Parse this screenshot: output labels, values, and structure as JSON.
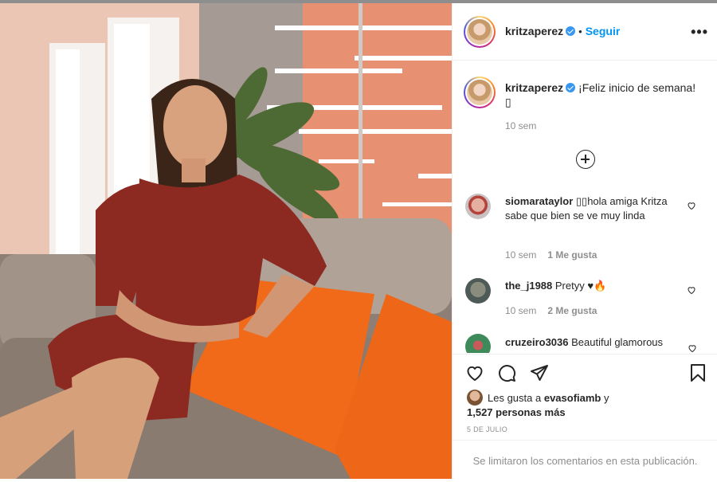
{
  "post": {
    "author": "kritzaperez",
    "follow_label": "Seguir",
    "more_label": "•••",
    "caption": "¡Feliz inicio de semana!",
    "caption_emoji": "▯",
    "caption_age": "10 sem"
  },
  "comments": [
    {
      "user": "siomarataylor",
      "text": "▯▯hola amiga Kritza sabe que bien se ve muy linda",
      "age": "10 sem",
      "likes": "1 Me gusta"
    },
    {
      "user": "the_j1988",
      "text": "Pretyy ♥🔥",
      "age": "10 sem",
      "likes": "2 Me gusta"
    },
    {
      "user": "cruzeiro3036",
      "text": "Beautiful glamorous"
    }
  ],
  "likes": {
    "prefix": "Les gusta a",
    "first_liker": "evasofiamb",
    "suffix": "y",
    "count_text": "1,527 personas más"
  },
  "date": "5 DE JULIO",
  "comments_limited": "Se limitaron los comentarios en esta publicación.",
  "icons": [
    "verified-badge-icon",
    "add-comments-icon",
    "heart-icon",
    "comment-icon",
    "share-icon",
    "save-icon",
    "more-options-icon"
  ],
  "colors": {
    "link": "#0095f6",
    "verified": "#3897f0",
    "muted": "#8e8e8e",
    "sofa_pillow": "#f06a1a",
    "dress": "#8c2a22"
  }
}
